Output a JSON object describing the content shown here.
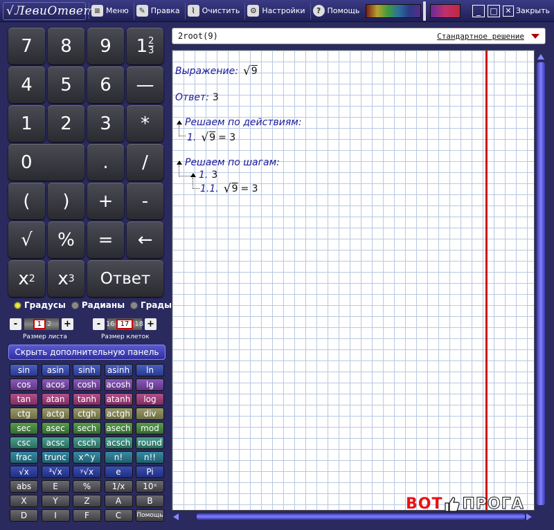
{
  "app": {
    "logo": "ЛевиОтвет",
    "menu": [
      {
        "label": "Меню",
        "icon": "menu-icon"
      },
      {
        "label": "Правка",
        "icon": "pencil-icon"
      },
      {
        "label": "Очистить",
        "icon": "broom-icon"
      },
      {
        "label": "Настройки",
        "icon": "gear-icon"
      },
      {
        "label": "Помощь",
        "icon": "help-icon"
      }
    ],
    "close_label": "Закрыть"
  },
  "keypad": {
    "k7": "7",
    "k8": "8",
    "k9": "9",
    "frac_whole": "1",
    "frac_num": "2",
    "frac_den": "3",
    "k4": "4",
    "k5": "5",
    "k6": "6",
    "dash": "—",
    "k1": "1",
    "k2": "2",
    "k3": "3",
    "mul": "*",
    "k0": "0",
    "dot": ".",
    "div": "/",
    "lparen": "(",
    "rparen": ")",
    "plus": "+",
    "minus": "-",
    "sqrt": "√",
    "percent": "%",
    "equals": "=",
    "backspace": "←",
    "sq_base": "x",
    "sq_exp": "2",
    "cube_base": "x",
    "cube_exp": "3",
    "answer": "Ответ"
  },
  "angle_units": [
    {
      "label": "Градусы",
      "selected": true
    },
    {
      "label": "Радианы",
      "selected": false
    },
    {
      "label": "Грады",
      "selected": false
    }
  ],
  "sheet_size": {
    "values": [
      "1",
      "2"
    ],
    "current": "1",
    "minus": "-",
    "plus": "+",
    "label": "Размер листа"
  },
  "cell_size": {
    "values": [
      "16",
      "17",
      "18"
    ],
    "current": "17",
    "minus": "-",
    "plus": "+",
    "label": "Размер клеток"
  },
  "extra_panel_button": "Скрыть дополнительную панель",
  "functions": [
    [
      "sin",
      "asin",
      "sinh",
      "asinh",
      "ln"
    ],
    [
      "cos",
      "acos",
      "cosh",
      "acosh",
      "lg"
    ],
    [
      "tan",
      "atan",
      "tanh",
      "atanh",
      "log"
    ],
    [
      "ctg",
      "actg",
      "ctgh",
      "actgh",
      "div"
    ],
    [
      "sec",
      "asec",
      "sech",
      "asech",
      "mod"
    ],
    [
      "csc",
      "acsc",
      "csch",
      "acsch",
      "round"
    ],
    [
      "frac",
      "trunc",
      "x^y",
      "n!",
      "n!!"
    ],
    [
      "√x",
      "³√x",
      "ʸ√x",
      "e",
      "Pi"
    ],
    [
      "abs",
      "E",
      "%",
      "1/x",
      "10ˣ"
    ],
    [
      "X",
      "Y",
      "Z",
      "A",
      "B"
    ],
    [
      "D",
      "I",
      "F",
      "C",
      "Помощь"
    ]
  ],
  "input": {
    "value": "2root(9)",
    "mode": "Стандартное решение"
  },
  "solution": {
    "expr_label": "Выражение:",
    "root_radicand": "9",
    "answer_label": "Ответ:",
    "answer_value": "3",
    "by_actions_label": "Решаем по действиям:",
    "action_1_num": "1.",
    "action_1_result": "= 3",
    "by_steps_label": "Решаем по шагам:",
    "step_1_num": "1.",
    "step_1_value": "3",
    "step_11_num": "1.1.",
    "step_11_result": "= 3"
  },
  "watermark": {
    "part1": "BOT",
    "part2": "ПРОГА"
  }
}
